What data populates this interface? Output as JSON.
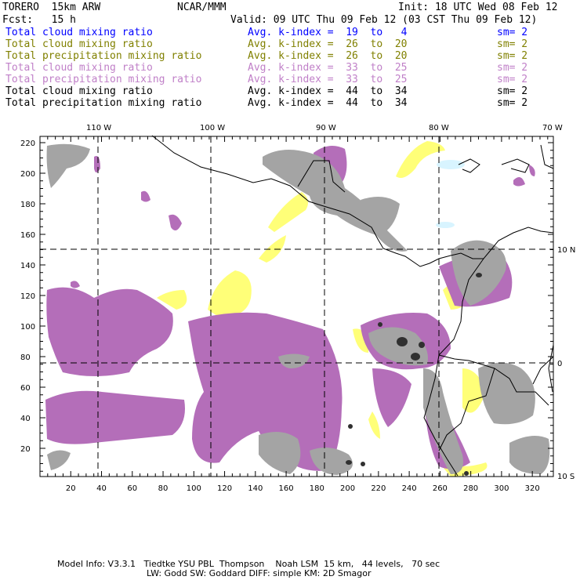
{
  "header": {
    "model": "TORERO  15km ARW",
    "org": "NCAR/MMM",
    "init": "Init: 18 UTC Wed 08 Feb 12",
    "fcst": "Fcst:   15 h",
    "valid": "Valid: 09 UTC Thu 09 Feb 12 (03 CST Thu 09 Feb 12)"
  },
  "legend": [
    {
      "field": "Total cloud mixing ratio",
      "kindex": "Avg. k-index =  19  to   4",
      "sm": "sm= 2",
      "color": "#0000ff"
    },
    {
      "field": "Total cloud mixing ratio",
      "kindex": "Avg. k-index =  26  to  20",
      "sm": "sm= 2",
      "color": "#808000"
    },
    {
      "field": "Total precipitation mixing ratio",
      "kindex": "Avg. k-index =  26  to  20",
      "sm": "sm= 2",
      "color": "#808000"
    },
    {
      "field": "Total cloud mixing ratio",
      "kindex": "Avg. k-index =  33  to  25",
      "sm": "sm= 2",
      "color": "#c080c8"
    },
    {
      "field": "Total precipitation mixing ratio",
      "kindex": "Avg. k-index =  33  to  25",
      "sm": "sm= 2",
      "color": "#c080c8"
    },
    {
      "field": "Total cloud mixing ratio",
      "kindex": "Avg. k-index =  44  to  34",
      "sm": "sm= 2",
      "color": "#000000"
    },
    {
      "field": "Total precipitation mixing ratio",
      "kindex": "Avg. k-index =  44  to  34",
      "sm": "sm= 2",
      "color": "#000000"
    }
  ],
  "axes": {
    "top": [
      "110 W",
      "100 W",
      "90 W",
      "80 W",
      "70 W"
    ],
    "right": [
      "10 N",
      "0",
      "10 S"
    ],
    "left": [
      "220",
      "200",
      "180",
      "160",
      "140",
      "120",
      "100",
      "80",
      "60",
      "40",
      "20"
    ],
    "bottom": [
      "20",
      "40",
      "60",
      "80",
      "100",
      "120",
      "140",
      "160",
      "180",
      "200",
      "220",
      "240",
      "260",
      "280",
      "300",
      "320"
    ]
  },
  "colors": {
    "purple": "#b46eb9",
    "gray": "#a4a4a4",
    "yellow": "#ffff78",
    "cyan": "#d8f4ff",
    "dark": "#303030"
  },
  "footer": {
    "line1": "Model Info: V3.3.1   Tiedtke YSU PBL  Thompson    Noah LSM  15 km,   44 levels,   70 sec",
    "line2": "LW: Godd SW: Goddard DIFF: simple KM: 2D Smagor"
  }
}
